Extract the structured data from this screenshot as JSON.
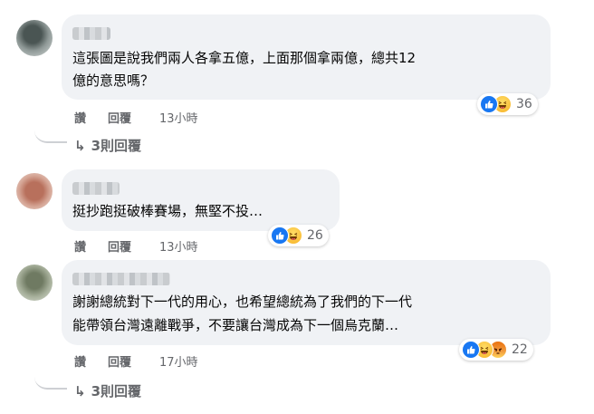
{
  "comments": [
    {
      "lines": [
        "這張圖是說我們兩人各拿五億，上面那個拿兩億，總共12",
        "億的意思嗎？"
      ],
      "actions": {
        "like": "讚",
        "reply": "回覆",
        "time": "13小時"
      },
      "reactions": {
        "icons": [
          "like-icon",
          "haha-icon"
        ],
        "count": "36"
      },
      "replies": "3則回覆"
    },
    {
      "lines": [
        "挺抄跑挺破棒賽場，無堅不投…"
      ],
      "actions": {
        "like": "讚",
        "reply": "回覆",
        "time": "13小時"
      },
      "reactions": {
        "icons": [
          "like-icon",
          "haha-icon"
        ],
        "count": "26"
      }
    },
    {
      "lines": [
        "謝謝總統對下一代的用心，也希望總統為了我們的下一代",
        "能帶領台灣遠離戰爭，不要讓台灣成為下一個烏克蘭…"
      ],
      "actions": {
        "like": "讚",
        "reply": "回覆",
        "time": "17小時"
      },
      "reactions": {
        "icons": [
          "like-icon",
          "haha-icon",
          "angry-icon"
        ],
        "count": "22"
      },
      "replies": "3則回覆"
    }
  ],
  "colors": {
    "bubble": "#f0f2f5",
    "meta": "#65676b",
    "like": "#1877f2",
    "haha": "#f7b125",
    "angry": "#e9710f"
  }
}
